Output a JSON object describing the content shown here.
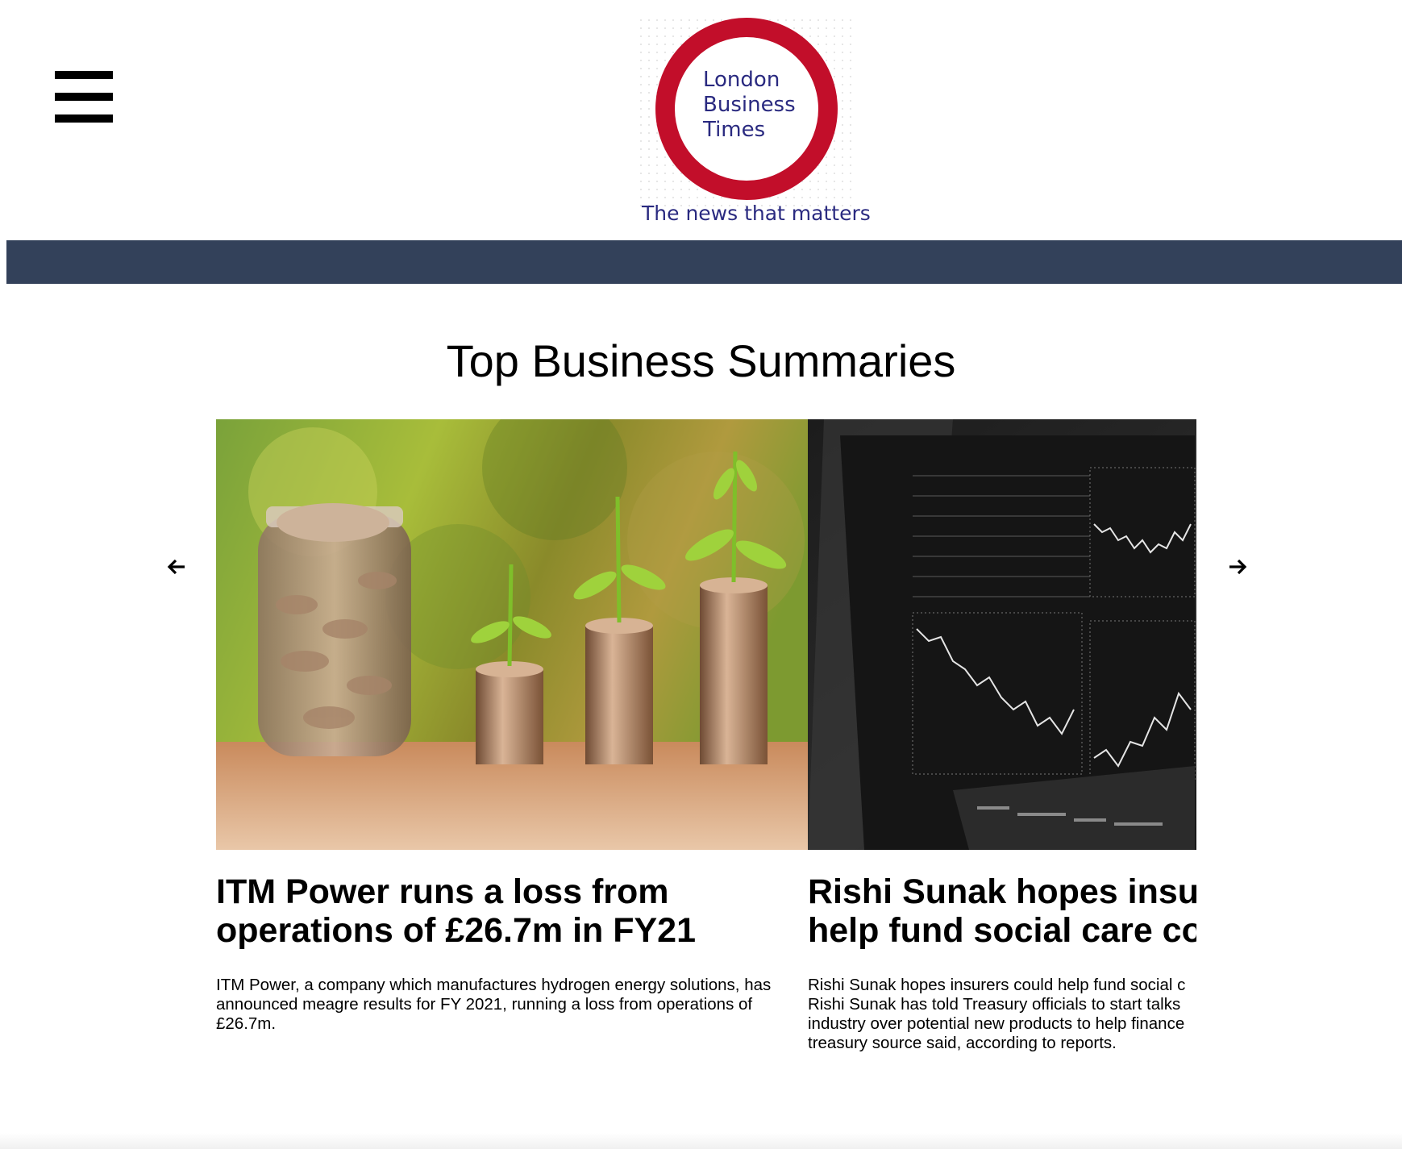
{
  "header": {
    "menu_icon": "hamburger-menu-icon",
    "logo": {
      "lines": "London\nBusiness\nTimes",
      "tagline": "The news that matters",
      "ring_color": "#c20e2a",
      "text_color": "#2a2a80"
    },
    "nav_bar_color": "#33415a"
  },
  "main": {
    "section_title": "Top Business Summaries",
    "carousel": {
      "prev_icon": "arrow-left-icon",
      "next_icon": "arrow-right-icon",
      "cards": [
        {
          "image": "coins-and-plants-photo",
          "title_line1": "ITM Power runs a loss from",
          "title_line2": "operations of £26.7m in FY21",
          "summary": "ITM Power, a company which manufactures hydrogen energy solutions, has announced meagre results for FY 2021, running a loss from operations of £26.7m."
        },
        {
          "image": "stock-market-screen-photo",
          "title_line1": "Rishi Sunak hopes insu",
          "title_line2": "help fund social care co",
          "summary_lines": [
            "Rishi Sunak hopes insurers could help fund social c",
            "Rishi Sunak has told Treasury officials to start talks",
            "industry over potential new products to help finance",
            "treasury source said, according to reports."
          ]
        }
      ]
    }
  }
}
